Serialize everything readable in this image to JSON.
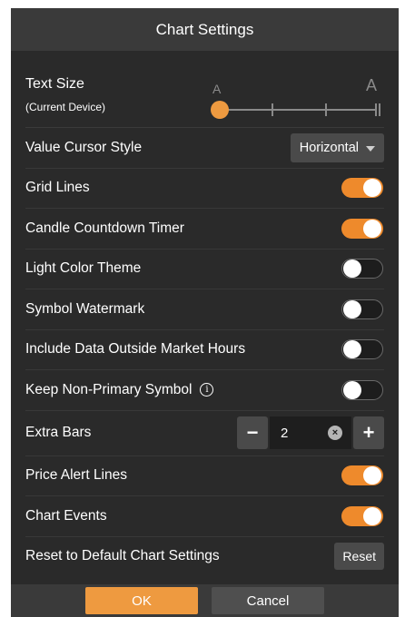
{
  "dialog": {
    "title": "Chart Settings"
  },
  "text_size": {
    "label": "Text Size",
    "sublabel": "(Current Device)",
    "small_a": "A",
    "large_a": "A",
    "level_fraction": 0
  },
  "value_cursor": {
    "label": "Value Cursor Style",
    "selected": "Horizontal"
  },
  "toggles": [
    {
      "label": "Grid Lines",
      "on": true
    },
    {
      "label": "Candle Countdown Timer",
      "on": true
    },
    {
      "label": "Light Color Theme",
      "on": false
    },
    {
      "label": "Symbol Watermark",
      "on": false
    },
    {
      "label": "Include Data Outside Market Hours",
      "on": false
    },
    {
      "label": "Keep Non-Primary Symbol",
      "on": false,
      "info": "i"
    }
  ],
  "extra_bars": {
    "label": "Extra Bars",
    "value": "2",
    "minus": "−",
    "plus": "+",
    "clear": "×"
  },
  "toggles2": [
    {
      "label": "Price Alert Lines",
      "on": true
    },
    {
      "label": "Chart Events",
      "on": true
    }
  ],
  "reset": {
    "label": "Reset to Default Chart Settings",
    "button": "Reset"
  },
  "footer": {
    "ok": "OK",
    "cancel": "Cancel"
  },
  "colors": {
    "accent": "#ee9a40",
    "toggle_on": "#ee8a2c",
    "background": "#2a2a2a",
    "titlebar": "#3a3a3a"
  }
}
